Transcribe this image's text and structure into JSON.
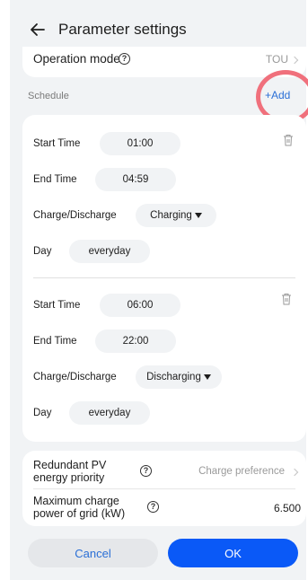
{
  "header": {
    "title": "Parameter settings"
  },
  "operation_mode": {
    "label": "Operation mode",
    "value": "TOU"
  },
  "schedule": {
    "label": "Schedule",
    "add_label": "+Add",
    "entries": [
      {
        "start_label": "Start Time",
        "start": "01:00",
        "end_label": "End Time",
        "end": "04:59",
        "mode_label": "Charge/Discharge",
        "mode": "Charging",
        "day_label": "Day",
        "day": "everyday"
      },
      {
        "start_label": "Start Time",
        "start": "06:00",
        "end_label": "End Time",
        "end": "22:00",
        "mode_label": "Charge/Discharge",
        "mode": "Discharging",
        "day_label": "Day",
        "day": "everyday"
      }
    ]
  },
  "settings": {
    "pv_priority": {
      "label_line1": "Redundant PV",
      "label_line2": "energy priority",
      "value": "Charge preference"
    },
    "max_charge": {
      "label_line1": "Maximum charge",
      "label_line2": "power of grid (kW)",
      "value": "6.500"
    }
  },
  "footer": {
    "cancel_label": "Cancel",
    "ok_label": "OK"
  },
  "colors": {
    "accent": "#0a59f7",
    "link": "#2a6fd6",
    "annotation": "#f0707c",
    "background": "#f1f3f5"
  }
}
